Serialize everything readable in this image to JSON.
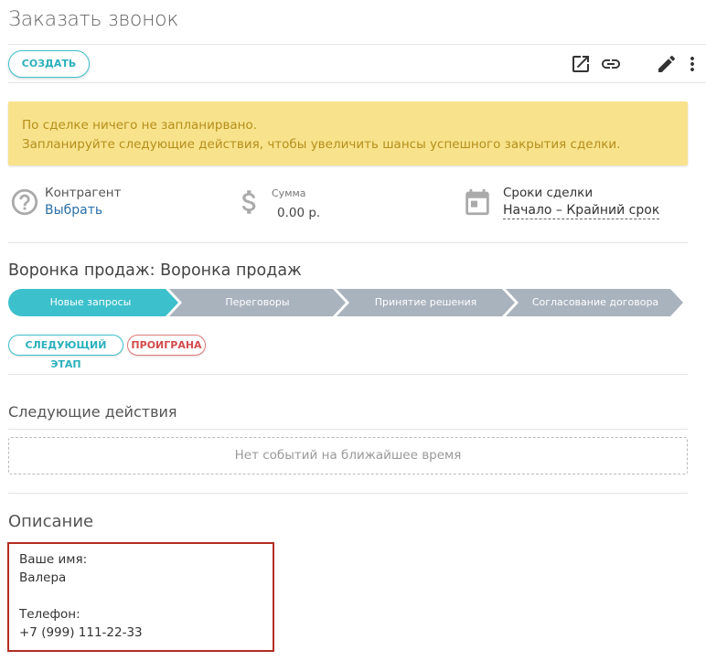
{
  "page": {
    "title": "Заказать звонок"
  },
  "toolbar": {
    "create_label": "СОЗДАТЬ",
    "icons": [
      "open-external-icon",
      "link-icon",
      "edit-pencil-icon",
      "more-vertical-icon"
    ]
  },
  "alert": {
    "line1": "По сделке ничего не запланирвано.",
    "line2": "Запланируйте следующие действия, чтобы увеличить шансы успешного закрытия сделки."
  },
  "info": {
    "contractor": {
      "label": "Контрагент",
      "link": "Выбрать",
      "icon": "help-circle-icon"
    },
    "amount": {
      "label": "Сумма",
      "value": "0.00 р.",
      "icon": "dollar-icon"
    },
    "dates": {
      "label": "Сроки сделки",
      "value": "Начало – Крайний срок",
      "icon": "calendar-icon"
    }
  },
  "funnel": {
    "title": "Воронка продаж: Воронка продаж",
    "stages": [
      {
        "label": "Новые запросы",
        "active": true
      },
      {
        "label": "Переговоры",
        "active": false
      },
      {
        "label": "Принятие решения",
        "active": false
      },
      {
        "label": "Согласование договора",
        "active": false
      }
    ],
    "next_stage_label": "СЛЕДУЮЩИЙ ЭТАП",
    "lost_label": "ПРОИГРАНА"
  },
  "next_actions": {
    "title": "Следующие действия",
    "empty_text": "Нет событий на ближайшее время"
  },
  "description": {
    "title": "Описание",
    "name_label": "Ваше имя:",
    "name_value": "Валера",
    "phone_label": "Телефон:",
    "phone_value": "+7 (999) 111-22-33"
  },
  "colors": {
    "accent": "#3cc0cc",
    "alert_bg": "#f8e38c",
    "alert_text": "#b58e1a",
    "stage_active": "#3cc0cc",
    "stage_inactive": "#a9b3be",
    "lost": "#d44b4b",
    "highlight_border": "#b32e22"
  }
}
